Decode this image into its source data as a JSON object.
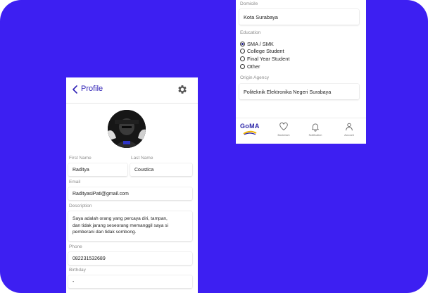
{
  "profile": {
    "title": "Profile",
    "first_name_label": "First Name",
    "first_name": "Raditya",
    "last_name_label": "Last Name",
    "last_name": "Coustica",
    "email_label": "Email",
    "email": "RadityasiPati@gmail.com",
    "description_label": "Description",
    "description": "Saya adalah orang yang percaya diri, tampan,\ndan tidak jarang seseorang memanggil saya si\npemberani dan tidak sombong.",
    "phone_label": "Phone",
    "phone": "082231532689",
    "birthday_label": "Birthday",
    "birthday": "-"
  },
  "detail": {
    "domicile_label": "Domicile",
    "domicile": "Kota Surabaya",
    "education_label": "Education",
    "education_options": [
      {
        "label": "SMA / SMK",
        "checked": true
      },
      {
        "label": "College Student",
        "checked": false
      },
      {
        "label": "Final Year Student",
        "checked": false
      },
      {
        "label": "Other",
        "checked": false
      }
    ],
    "origin_agency_label": "Origin Agency",
    "origin_agency": "Politeknik Elektronika Negeri Surabaya"
  },
  "bottom_nav": {
    "logo_text": "GoMA",
    "items": [
      {
        "label": "Bookmark",
        "icon": "heart-icon"
      },
      {
        "label": "Notification",
        "icon": "bell-icon"
      },
      {
        "label": "Account",
        "icon": "person-icon"
      }
    ]
  },
  "colors": {
    "background": "#3d1ff2",
    "accent": "#3022b6",
    "logo_yellow": "#f0b400"
  }
}
